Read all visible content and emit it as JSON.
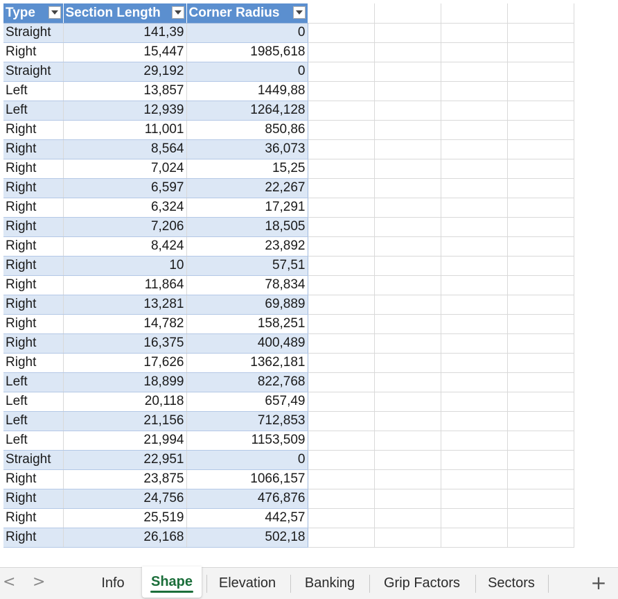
{
  "table": {
    "headers": [
      "Type",
      "Section Length",
      "Corner Radius"
    ],
    "rows": [
      [
        "Straight",
        "141,39",
        "0"
      ],
      [
        "Right",
        "15,447",
        "1985,618"
      ],
      [
        "Straight",
        "29,192",
        "0"
      ],
      [
        "Left",
        "13,857",
        "1449,88"
      ],
      [
        "Left",
        "12,939",
        "1264,128"
      ],
      [
        "Right",
        "11,001",
        "850,86"
      ],
      [
        "Right",
        "8,564",
        "36,073"
      ],
      [
        "Right",
        "7,024",
        "15,25"
      ],
      [
        "Right",
        "6,597",
        "22,267"
      ],
      [
        "Right",
        "6,324",
        "17,291"
      ],
      [
        "Right",
        "7,206",
        "18,505"
      ],
      [
        "Right",
        "8,424",
        "23,892"
      ],
      [
        "Right",
        "10",
        "57,51"
      ],
      [
        "Right",
        "11,864",
        "78,834"
      ],
      [
        "Right",
        "13,281",
        "69,889"
      ],
      [
        "Right",
        "14,782",
        "158,251"
      ],
      [
        "Right",
        "16,375",
        "400,489"
      ],
      [
        "Right",
        "17,626",
        "1362,181"
      ],
      [
        "Left",
        "18,899",
        "822,768"
      ],
      [
        "Left",
        "20,118",
        "657,49"
      ],
      [
        "Left",
        "21,156",
        "712,853"
      ],
      [
        "Left",
        "21,994",
        "1153,509"
      ],
      [
        "Straight",
        "22,951",
        "0"
      ],
      [
        "Right",
        "23,875",
        "1066,157"
      ],
      [
        "Right",
        "24,756",
        "476,876"
      ],
      [
        "Right",
        "25,519",
        "442,57"
      ],
      [
        "Right",
        "26,168",
        "502,18"
      ]
    ]
  },
  "sheet_tabs": {
    "prev_arrow": "<",
    "next_arrow": ">",
    "tabs": [
      "Info",
      "Shape",
      "Elevation",
      "Banking",
      "Grip Factors",
      "Sectors"
    ],
    "active": "Shape",
    "add_label": "+"
  },
  "colors": {
    "header_bg": "#5b8fcf",
    "band_bg": "#dce7f5",
    "active_tab": "#1b6e3a"
  },
  "icons": {
    "filter": "chevron-down-icon",
    "add": "plus-icon"
  }
}
